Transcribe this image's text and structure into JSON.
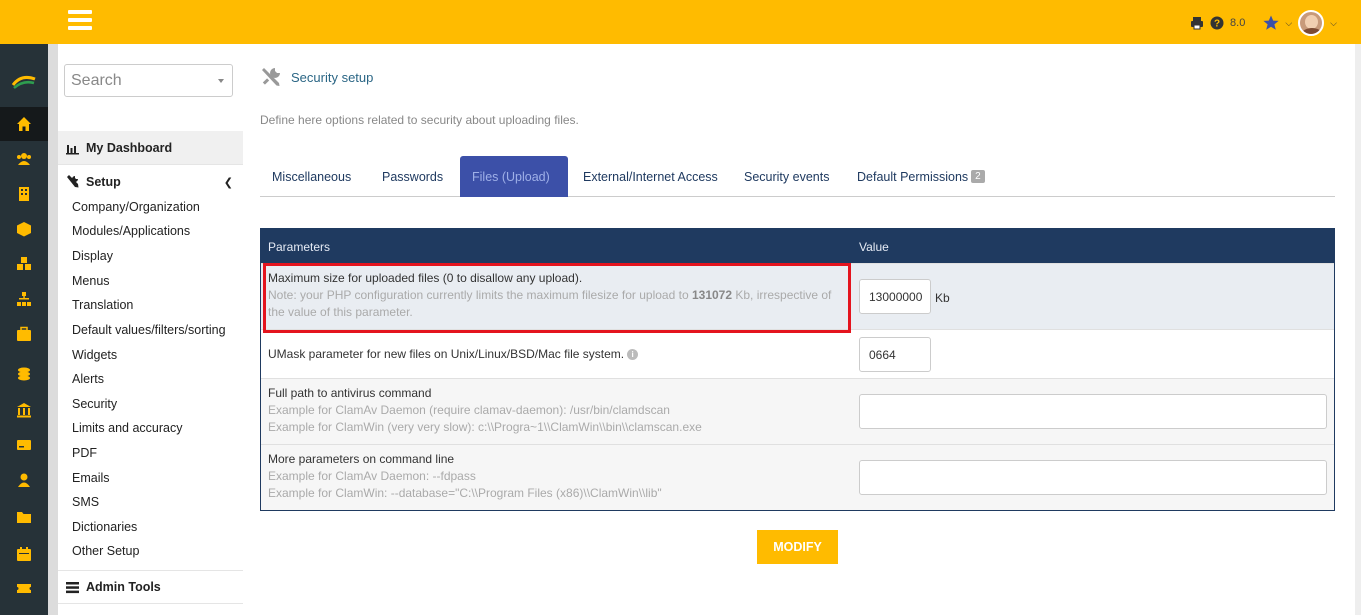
{
  "topbar": {
    "version": "8.0"
  },
  "sidebar": {
    "search_placeholder": "Search",
    "dashboard_label": "My Dashboard",
    "setup_label": "Setup",
    "items": [
      "Company/Organization",
      "Modules/Applications",
      "Display",
      "Menus",
      "Translation",
      "Default values/filters/sorting",
      "Widgets",
      "Alerts",
      "Security",
      "Limits and accuracy",
      "PDF",
      "Emails",
      "SMS",
      "Dictionaries",
      "Other Setup"
    ],
    "admin_tools_label": "Admin Tools"
  },
  "page": {
    "title": "Security setup",
    "description": "Define here options related to security about uploading files."
  },
  "tabs": [
    {
      "label": "Miscellaneous"
    },
    {
      "label": "Passwords"
    },
    {
      "label": "Files (Upload)",
      "active": true
    },
    {
      "label": "External/Internet Access"
    },
    {
      "label": "Security events"
    },
    {
      "label": "Default Permissions",
      "badge": "2"
    }
  ],
  "table": {
    "col_parameters": "Parameters",
    "col_value": "Value",
    "rows": [
      {
        "label": "Maximum size for uploaded files (0 to disallow any upload).",
        "note_pre": "Note: your PHP configuration currently limits the maximum filesize for upload to ",
        "note_bold": "131072",
        "note_post": " Kb, irrespective of the value of this parameter.",
        "value": "13000000",
        "unit": "Kb"
      },
      {
        "label": "UMask parameter for new files on Unix/Linux/BSD/Mac file system.",
        "info_icon": "i",
        "value": "0664"
      },
      {
        "label": "Full path to antivirus command",
        "example1": "Example for ClamAv Daemon (require clamav-daemon): /usr/bin/clamdscan",
        "example2": "Example for ClamWin (very very slow): c:\\\\Progra~1\\\\ClamWin\\\\bin\\\\clamscan.exe",
        "value": ""
      },
      {
        "label": "More parameters on command line",
        "example1": "Example for ClamAv Daemon: --fdpass",
        "example2": "Example for ClamWin: --database=\"C:\\\\Program Files (x86)\\\\ClamWin\\\\lib\"",
        "value": ""
      }
    ]
  },
  "actions": {
    "modify_label": "MODIFY"
  },
  "colors": {
    "accent": "#ffbb00",
    "navbar": "#263238",
    "table_header": "#1f3a60",
    "active_tab": "#3c50a8",
    "highlight": "#e4141e"
  }
}
